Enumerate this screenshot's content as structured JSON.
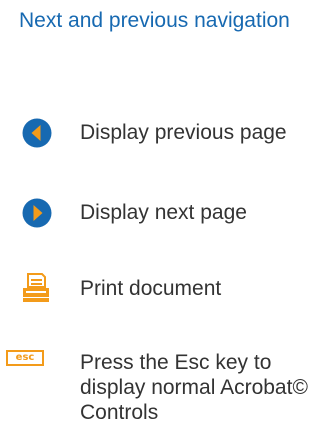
{
  "header": {
    "title": "Next and previous navigation"
  },
  "items": [
    {
      "icon": "previous-page-icon",
      "label": "Display previous page",
      "color": "#1769b1",
      "accent": "#f39b1a"
    },
    {
      "icon": "next-page-icon",
      "label": "Display next page",
      "color": "#1769b1",
      "accent": "#f39b1a"
    },
    {
      "icon": "printer-icon",
      "label": "Print document",
      "color": "#f39b1a"
    },
    {
      "icon": "esc-key-icon",
      "key_label": "esc",
      "label": "Press the Esc key to display normal Acrobat© Controls",
      "color": "#f39b1a"
    }
  ]
}
